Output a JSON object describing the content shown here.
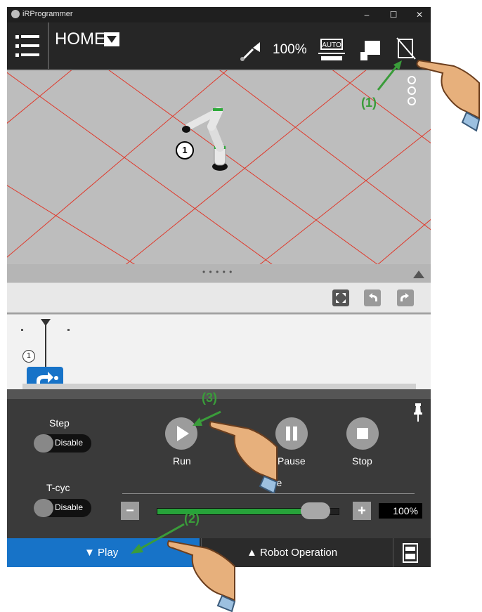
{
  "window": {
    "title": "iRProgrammer",
    "controls": [
      "–",
      "☐",
      "✕"
    ]
  },
  "topbar": {
    "title": "HOME",
    "speed": "100%",
    "auto_label": "AUTO"
  },
  "view": {
    "marker": "1"
  },
  "timeline": {
    "node_label": "1"
  },
  "control_panel": {
    "step_label": "Step",
    "step_value": "Disable",
    "tcyc_label": "T-cyc",
    "tcyc_value": "Disable",
    "run_label": "Run",
    "pause_label": "Pause",
    "stop_label": "Stop",
    "override_label": "ride",
    "override_value": "100%",
    "override_fraction": 0.93,
    "minus": "−",
    "plus": "+"
  },
  "bottom": {
    "play_label": "▼ Play",
    "robot_op_label": "▲ Robot Operation"
  },
  "annotations": {
    "a1": "(1)",
    "a2": "(2)",
    "a3": "(3)"
  },
  "colors": {
    "accent": "#1773c8",
    "annotation": "#3a9c3a",
    "slider": "#27a33a",
    "grid": "#e0392b"
  }
}
